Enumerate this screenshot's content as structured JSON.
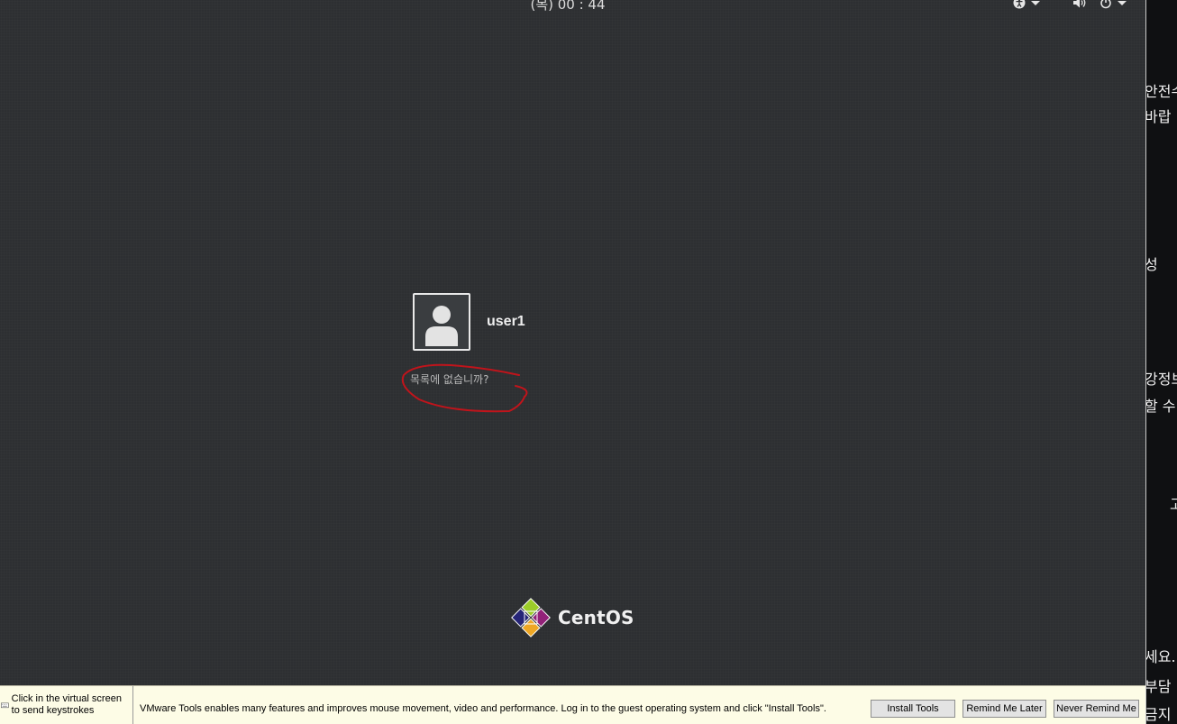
{
  "top_bar": {
    "clock": "(목) 00 : 44",
    "accessibility_icon": "accessibility-icon",
    "volume_icon": "volume-icon",
    "power_icon": "power-icon"
  },
  "login": {
    "username": "user1",
    "avatar_icon": "user-avatar-icon",
    "not_listed_link": "목록에 없습니까?",
    "annotation_color": "#c0141b"
  },
  "branding": {
    "wordmark": "CentOS"
  },
  "vmware_bar": {
    "keystroke_hint": "Click in the virtual screen to send keystrokes",
    "message": "VMware Tools enables many features and improves mouse movement, video and performance. Log in to the guest operating system and click \"Install Tools\".",
    "install_tools_label": "Install Tools",
    "remind_later_label": "Remind Me Later",
    "never_remind_label": "Never Remind Me"
  },
  "host_background": {
    "fragments": [
      "안전수",
      "바랍",
      "성",
      "강정보",
      "할 수 있",
      "고",
      "세요.",
      "부담",
      "금지"
    ]
  },
  "colors": {
    "screen_bg": "#2d2f32",
    "bar_bg": "#fdfce6"
  }
}
